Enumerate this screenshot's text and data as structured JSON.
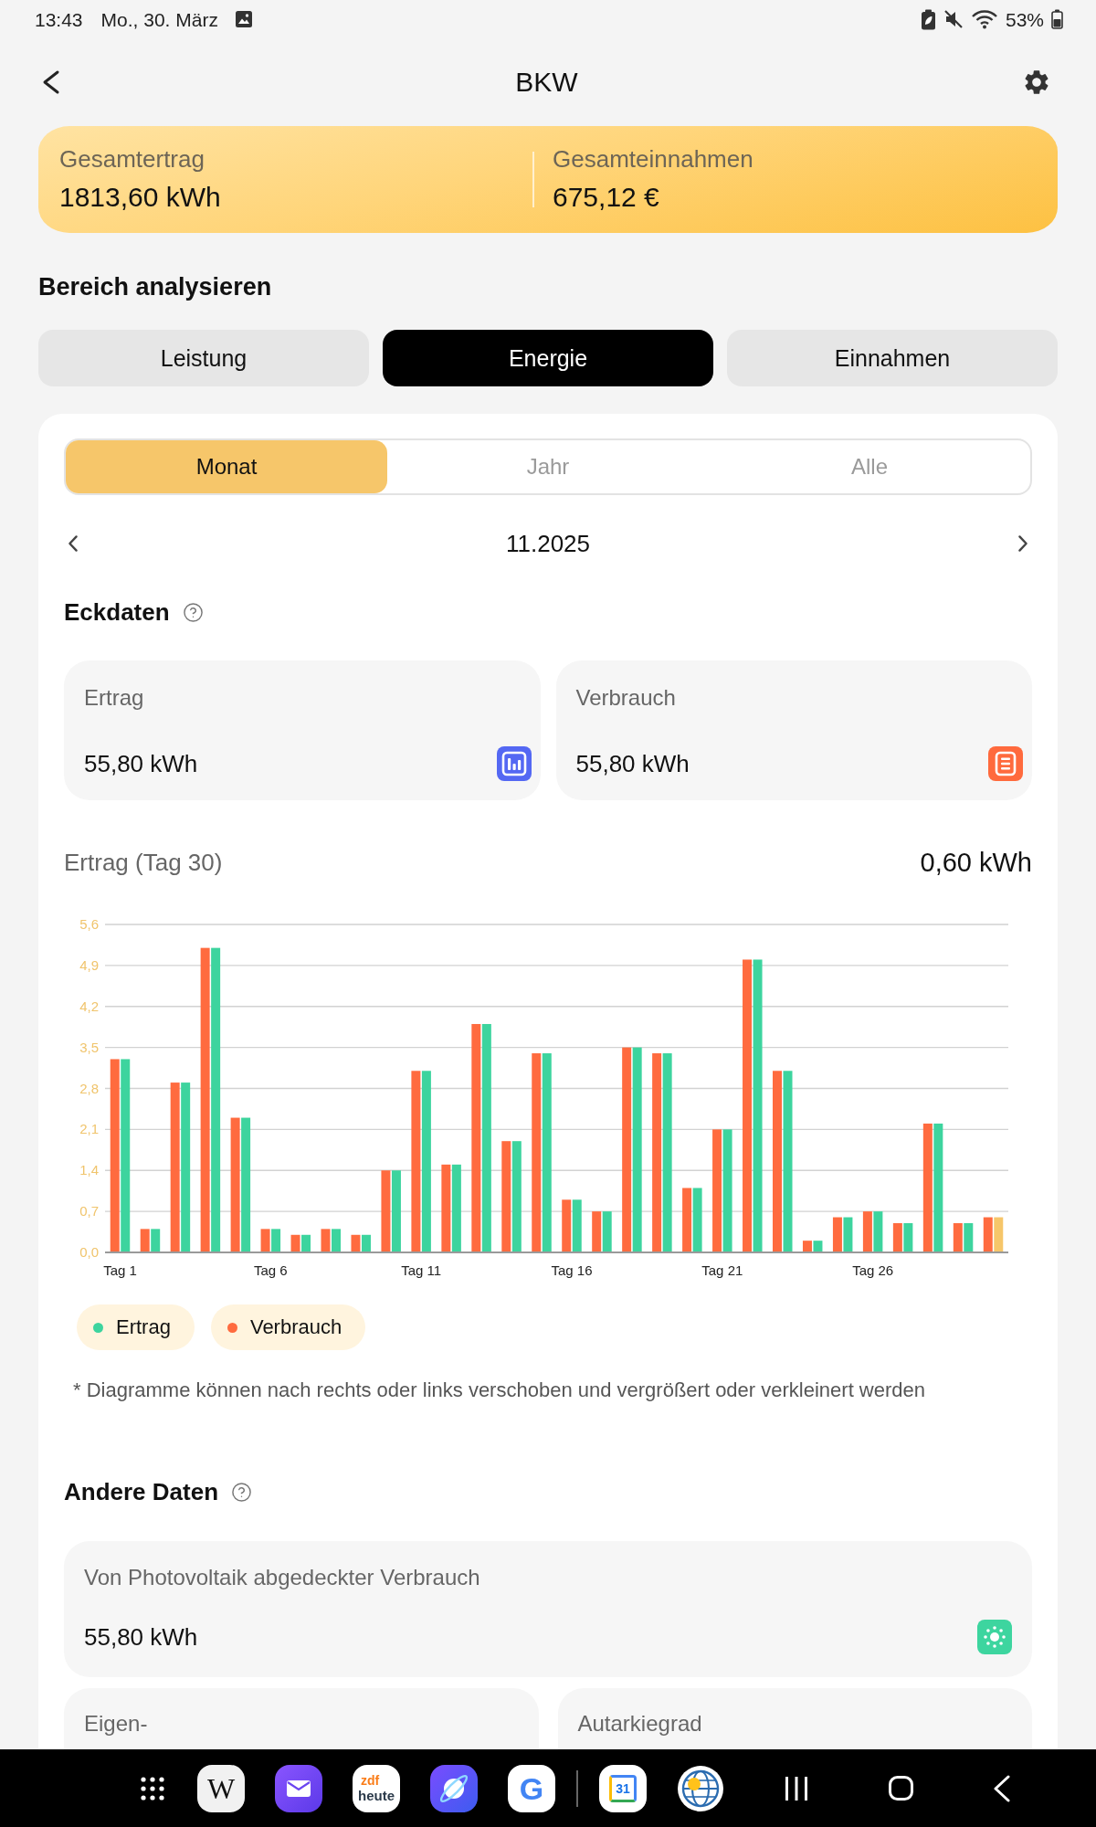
{
  "status_bar": {
    "time": "13:43",
    "date": "Mo., 30. März",
    "battery": "53%"
  },
  "header": {
    "title": "BKW"
  },
  "summary": [
    {
      "label": "Gesamtertrag",
      "value": "1813,60 kWh"
    },
    {
      "label": "Gesamteinnahmen",
      "value": "675,12 €"
    }
  ],
  "analysis": {
    "title": "Bereich analysieren",
    "tabs": [
      {
        "label": "Leistung",
        "selected": false
      },
      {
        "label": "Energie",
        "selected": true
      },
      {
        "label": "Einnahmen",
        "selected": false
      }
    ]
  },
  "period": {
    "tabs": [
      {
        "label": "Monat",
        "selected": true
      },
      {
        "label": "Jahr",
        "selected": false
      },
      {
        "label": "Alle",
        "selected": false
      }
    ],
    "value": "11.2025"
  },
  "key_data": {
    "title": "Eckdaten",
    "cards": [
      {
        "label": "Ertrag",
        "value": "55,80 kWh",
        "kind": "bars",
        "color": "#5468f3"
      },
      {
        "label": "Verbrauch",
        "value": "55,80 kWh",
        "kind": "list",
        "color": "#ff6a3d"
      }
    ]
  },
  "chart": {
    "reading": "0,60 kWh",
    "chart_data": {
      "type": "bar",
      "categories": [
        "Tag 1",
        null,
        null,
        null,
        null,
        "Tag 6",
        null,
        null,
        null,
        null,
        "Tag 11",
        null,
        null,
        null,
        null,
        "Tag 16",
        null,
        null,
        null,
        null,
        "Tag 21",
        null,
        null,
        null,
        null,
        "Tag 26",
        null,
        null,
        null,
        null
      ],
      "series": [
        {
          "name": "Verbrauch",
          "color": "#ff6b3f",
          "values": [
            3.3,
            0.4,
            2.9,
            5.2,
            2.3,
            0.4,
            0.3,
            0.4,
            0.3,
            1.4,
            3.1,
            1.5,
            3.9,
            1.9,
            3.4,
            0.9,
            0.7,
            3.5,
            3.4,
            1.1,
            2.1,
            5.0,
            3.1,
            0.2,
            0.6,
            0.7,
            0.5,
            2.2,
            0.5,
            0.6
          ]
        },
        {
          "name": "Ertrag",
          "color": "#3dd49e",
          "values": [
            3.3,
            0.4,
            2.9,
            5.2,
            2.3,
            0.4,
            0.3,
            0.4,
            0.3,
            1.4,
            3.1,
            1.5,
            3.9,
            1.9,
            3.4,
            0.9,
            0.7,
            3.5,
            3.4,
            1.1,
            2.1,
            5.0,
            3.1,
            0.2,
            0.6,
            0.7,
            0.5,
            2.2,
            0.5,
            null
          ]
        },
        {
          "name": "Ertrag (Tag 30)",
          "color": "#f6c66a",
          "values": [
            null,
            null,
            null,
            null,
            null,
            null,
            null,
            null,
            null,
            null,
            null,
            null,
            null,
            null,
            null,
            null,
            null,
            null,
            null,
            null,
            null,
            null,
            null,
            null,
            null,
            null,
            null,
            null,
            null,
            0.6
          ]
        }
      ],
      "ylim": [
        0,
        5.6
      ],
      "yticks": [
        {
          "value": 0,
          "label": "0,0"
        },
        {
          "value": 0.7,
          "label": "0,7"
        },
        {
          "value": 1.4,
          "label": "1,4"
        },
        {
          "value": 2.1,
          "label": "2,1"
        },
        {
          "value": 2.8,
          "label": "2,8"
        },
        {
          "value": 3.5,
          "label": "3,5"
        },
        {
          "value": 4.2,
          "label": "4,2"
        },
        {
          "value": 4.9,
          "label": "4,9"
        },
        {
          "value": 5.6,
          "label": "5,6"
        }
      ],
      "grid": true
    },
    "note": "* Diagramme können nach rechts oder links verschoben und vergrößert oder verkleinert werden"
  },
  "other_data": {
    "title": "Andere Daten",
    "main_card": {
      "label": "Von Photovoltaik abgedeckter Verbrauch",
      "value": "55,80 kWh",
      "kind": "sun",
      "color": "#3dd59f"
    },
    "cards": [
      {
        "label": "Eigen-"
      },
      {
        "label": "Autarkiegrad"
      }
    ]
  },
  "nav_bar": {
    "dock": [
      {
        "kind": "apps"
      },
      {
        "kind": "wiki",
        "label": "W"
      },
      {
        "kind": "mail"
      },
      {
        "kind": "news",
        "label": "zdf",
        "sublabel": "heute"
      },
      {
        "kind": "browser"
      },
      {
        "kind": "google",
        "label": "G"
      },
      {
        "kind": "divider"
      },
      {
        "kind": "calendar",
        "label": "31"
      },
      {
        "kind": "weather"
      }
    ],
    "buttons": [
      {
        "kind": "recents"
      },
      {
        "kind": "home"
      },
      {
        "kind": "back"
      }
    ]
  }
}
